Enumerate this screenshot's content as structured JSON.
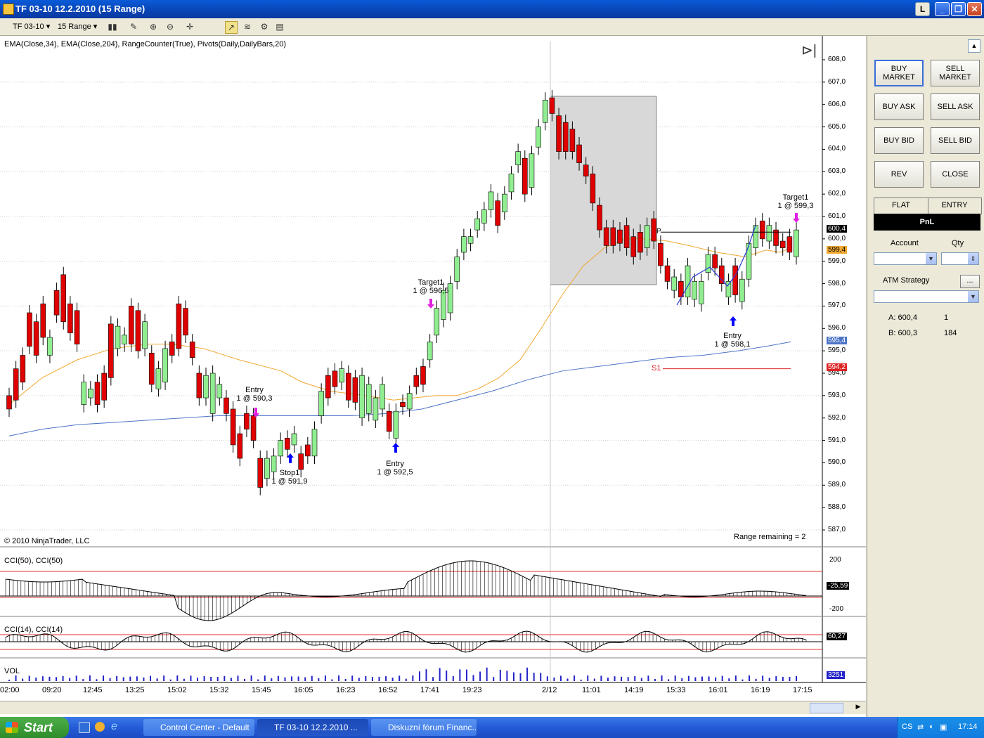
{
  "window": {
    "title": "TF 03-10  12.2.2010 (15 Range)",
    "btn_l": "L"
  },
  "toolbar": {
    "instrument": "TF 03-10",
    "period": "15 Range"
  },
  "indicators_label": "EMA(Close,34), EMA(Close,204), RangeCounter(True), Pivots(Daily,DailyBars,20)",
  "copyright": "© 2010 NinjaTrader, LLC",
  "range_remaining": "Range remaining = 2",
  "price_axis": [
    "608,0",
    "607,0",
    "606,0",
    "605,0",
    "604,0",
    "603,0",
    "602,0",
    "601,0",
    "600,0",
    "599,0",
    "598,0",
    "597,0",
    "596,0",
    "595,0",
    "594,0",
    "593,0",
    "592,0",
    "591,0",
    "590,0",
    "589,0",
    "588,0",
    "587,0"
  ],
  "price_tags": {
    "last": "600,4",
    "ema34": "599,4",
    "ema204": "595,4",
    "s1": "594,2"
  },
  "pivot_labels": {
    "p": "P",
    "s1": "S1"
  },
  "annotations": {
    "entry1": [
      "Entry",
      "1 @ 590,3"
    ],
    "stop1": [
      "Stop1",
      "1 @ 591,9"
    ],
    "entry2": [
      "Entry",
      "1 @ 592,5"
    ],
    "target1a": [
      "Target1",
      "1 @ 596,5"
    ],
    "entry3": [
      "Entry",
      "1 @ 598,1"
    ],
    "target1b": [
      "Target1",
      "1 @ 599,3"
    ]
  },
  "cci1": {
    "label": "CCI(50), CCI(50)",
    "ticks": [
      "200",
      "-200"
    ],
    "value": "-25,59"
  },
  "cci2": {
    "label": "CCI(14), CCI(14)",
    "value": "60,27"
  },
  "vol": {
    "label": "VOL",
    "value": "3251"
  },
  "time_axis": [
    "02:00",
    "09:20",
    "12:45",
    "13:25",
    "15:02",
    "15:32",
    "15:45",
    "16:05",
    "16:23",
    "16:52",
    "17:41",
    "19:23",
    "2/12",
    "11:01",
    "14:19",
    "15:33",
    "16:01",
    "16:19",
    "17:15"
  ],
  "side": {
    "buttons": [
      [
        "BUY",
        "MARKET"
      ],
      [
        "SELL",
        "MARKET"
      ],
      [
        "BUY ASK"
      ],
      [
        "SELL ASK"
      ],
      [
        "BUY BID"
      ],
      [
        "SELL BID"
      ],
      [
        "REV"
      ],
      [
        "CLOSE"
      ]
    ],
    "flat": "FLAT",
    "entry": "ENTRY",
    "pnl": "PnL",
    "account_label": "Account",
    "qty_label": "Qty",
    "atm_label": "ATM Strategy",
    "atm_btn": "...",
    "ask_label": "A: 600,4",
    "ask_qty": "1",
    "bid_label": "B: 600,3",
    "bid_qty": "184"
  },
  "taskbar": {
    "start": "Start",
    "tasks": [
      "Control Center - Default",
      "TF 03-10  12.2.2010 ...",
      "Diskuzní fórum Financ..."
    ],
    "lang": "CS",
    "clock": "17:14"
  },
  "chart_data": {
    "type": "candlestick",
    "title": "TF 03-10  12.2.2010 (15 Range)",
    "ylim": [
      586.6,
      608.4
    ],
    "candles": [
      [
        593.0,
        592.4
      ],
      [
        594.2,
        592.8
      ],
      [
        594.8,
        593.6
      ],
      [
        596.7,
        595.2
      ],
      [
        596.3,
        594.8
      ],
      [
        597.1,
        595.6
      ],
      [
        594.8,
        595.6
      ],
      [
        597.7,
        596.6
      ],
      [
        598.4,
        596.3
      ],
      [
        597.1,
        595.8
      ],
      [
        596.8,
        595.3
      ],
      [
        592.6,
        593.6
      ],
      [
        592.9,
        593.3
      ],
      [
        593.6,
        592.6
      ],
      [
        594.0,
        592.8
      ],
      [
        596.2,
        593.8
      ],
      [
        595.1,
        596.1
      ],
      [
        595.3,
        595.7
      ],
      [
        597.0,
        595.3
      ],
      [
        596.8,
        595.0
      ],
      [
        595.1,
        596.3
      ],
      [
        594.9,
        593.5
      ],
      [
        593.3,
        594.2
      ],
      [
        593.6,
        595.1
      ],
      [
        595.4,
        594.8
      ],
      [
        597.1,
        595.1
      ],
      [
        596.9,
        595.7
      ],
      [
        595.4,
        594.7
      ],
      [
        594.0,
        592.9
      ],
      [
        592.9,
        593.9
      ],
      [
        592.2,
        594.0
      ],
      [
        592.9,
        593.5
      ],
      [
        592.9,
        592.2
      ],
      [
        592.4,
        590.8
      ],
      [
        591.3,
        590.2
      ],
      [
        592.2,
        591.5
      ],
      [
        592.1,
        591.0
      ],
      [
        590.2,
        588.9
      ],
      [
        589.3,
        590.2
      ],
      [
        589.6,
        590.3
      ],
      [
        590.3,
        591.0
      ],
      [
        591.1,
        590.6
      ],
      [
        590.8,
        591.3
      ],
      [
        590.4,
        589.7
      ],
      [
        590.8,
        590.3
      ],
      [
        590.3,
        591.5
      ],
      [
        592.1,
        593.2
      ],
      [
        593.9,
        592.9
      ],
      [
        594.1,
        593.4
      ],
      [
        593.6,
        594.2
      ],
      [
        594.0,
        592.8
      ],
      [
        593.8,
        592.7
      ],
      [
        592.0,
        593.9
      ],
      [
        592.2,
        593.5
      ],
      [
        591.9,
        592.9
      ],
      [
        592.4,
        593.5
      ],
      [
        592.3,
        591.4
      ],
      [
        591.1,
        592.3
      ],
      [
        592.7,
        592.5
      ],
      [
        592.4,
        593.1
      ],
      [
        593.9,
        593.4
      ],
      [
        594.3,
        593.5
      ],
      [
        594.6,
        595.4
      ],
      [
        595.7,
        596.9
      ],
      [
        596.4,
        597.7
      ],
      [
        596.7,
        598.0
      ],
      [
        598.1,
        599.2
      ],
      [
        599.4,
        600.1
      ],
      [
        599.8,
        600.1
      ],
      [
        600.4,
        600.9
      ],
      [
        600.7,
        601.3
      ],
      [
        601.3,
        602.1
      ],
      [
        601.7,
        600.6
      ],
      [
        601.2,
        602.0
      ],
      [
        602.1,
        602.9
      ],
      [
        603.3,
        603.9
      ],
      [
        603.6,
        602.0
      ],
      [
        602.3,
        603.8
      ],
      [
        604.1,
        605.0
      ],
      [
        605.2,
        606.2
      ],
      [
        606.3,
        605.6
      ],
      [
        605.5,
        603.9
      ],
      [
        605.2,
        603.9
      ],
      [
        604.9,
        603.9
      ],
      [
        604.2,
        603.4
      ],
      [
        603.3,
        602.8
      ],
      [
        602.9,
        601.6
      ],
      [
        601.5,
        600.4
      ],
      [
        600.5,
        599.7
      ],
      [
        600.5,
        599.7
      ],
      [
        600.4,
        599.8
      ],
      [
        600.6,
        599.6
      ],
      [
        600.1,
        599.2
      ],
      [
        600.3,
        599.4
      ],
      [
        599.6,
        600.6
      ],
      [
        600.9,
        599.9
      ],
      [
        599.8,
        598.8
      ],
      [
        598.8,
        598.1
      ],
      [
        597.7,
        598.3
      ],
      [
        598.1,
        597.4
      ],
      [
        597.4,
        598.8
      ],
      [
        597.3,
        598.1
      ],
      [
        597.1,
        598.1
      ],
      [
        598.5,
        599.3
      ],
      [
        599.3,
        598.7
      ],
      [
        598.8,
        598.0
      ],
      [
        597.4,
        598.1
      ],
      [
        598.8,
        597.5
      ],
      [
        597.2,
        598.2
      ],
      [
        598.2,
        599.8
      ],
      [
        599.6,
        600.6
      ],
      [
        600.8,
        600.0
      ],
      [
        599.9,
        600.6
      ],
      [
        600.4,
        599.7
      ],
      [
        599.9,
        599.6
      ],
      [
        600.1,
        599.4
      ],
      [
        599.2,
        600.4
      ]
    ],
    "series": [
      {
        "name": "EMA(Close,34)",
        "values": [
          592.6,
          593.8,
          594.6,
          595.1,
          595.3,
          595.3,
          595.1,
          594.6,
          594.1,
          593.6,
          593.2,
          593.0,
          592.8,
          592.9,
          593.0,
          593.0,
          593.3,
          593.8,
          594.6,
          596.0,
          597.5,
          598.8,
          599.6,
          600.0,
          600.0,
          599.9,
          599.7,
          599.4,
          599.2,
          599.5,
          599.4,
          599.6
        ]
      },
      {
        "name": "EMA(Close,204)",
        "values": [
          591.2,
          591.5,
          591.7,
          591.8,
          591.9,
          592.0,
          592.1,
          592.1,
          592.1,
          592.1,
          592.1,
          592.2,
          592.4,
          592.8,
          593.2,
          593.7,
          594.1,
          594.3,
          594.5,
          594.7,
          594.8,
          595.0,
          595.2,
          595.4
        ]
      }
    ]
  }
}
